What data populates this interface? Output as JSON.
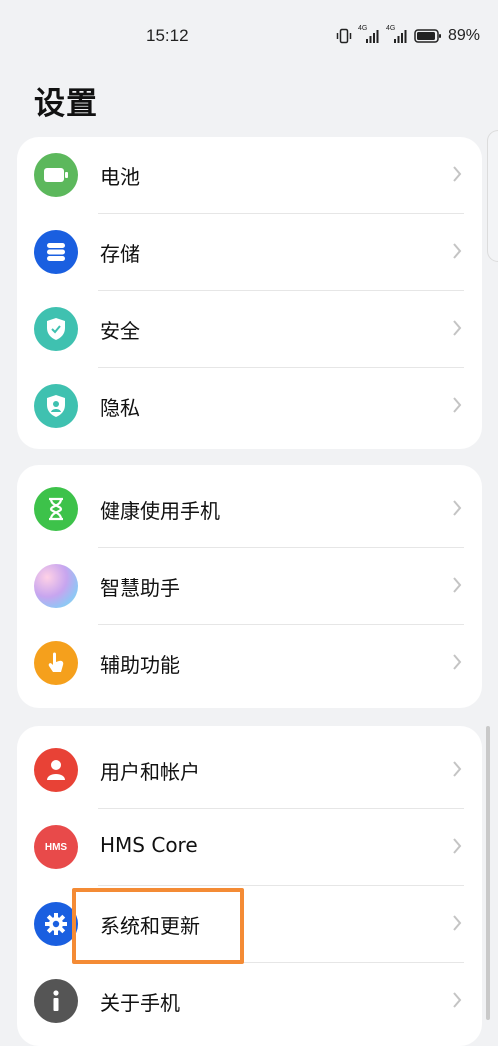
{
  "status": {
    "time": "15:12",
    "battery_percent": "89%",
    "signal1_label": "4G",
    "signal2_label": "4G"
  },
  "page": {
    "title": "设置"
  },
  "groups": [
    {
      "items": [
        {
          "label": "电池",
          "icon": "battery-icon",
          "color": "#5cb85c"
        },
        {
          "label": "存储",
          "icon": "storage-icon",
          "color": "#1a5fe0"
        },
        {
          "label": "安全",
          "icon": "shield-icon",
          "color": "#3fc1b0"
        },
        {
          "label": "隐私",
          "icon": "privacy-icon",
          "color": "#3fc1b0"
        }
      ]
    },
    {
      "items": [
        {
          "label": "健康使用手机",
          "icon": "hourglass-icon",
          "color": "#3dc24a"
        },
        {
          "label": "智慧助手",
          "icon": "assistant-icon",
          "color": "#c7a5ef"
        },
        {
          "label": "辅助功能",
          "icon": "hand-icon",
          "color": "#f5a01c"
        }
      ]
    },
    {
      "items": [
        {
          "label": "用户和帐户",
          "icon": "user-icon",
          "color": "#e84236"
        },
        {
          "label": "HMS Core",
          "icon": "hms-icon",
          "color": "#e84a4a",
          "icon_text": "HMS"
        },
        {
          "label": "系统和更新",
          "icon": "gear-icon",
          "color": "#1a5fe0"
        },
        {
          "label": "关于手机",
          "icon": "info-icon",
          "color": "#555555"
        }
      ]
    }
  ],
  "highlight_color": "#f48b35"
}
